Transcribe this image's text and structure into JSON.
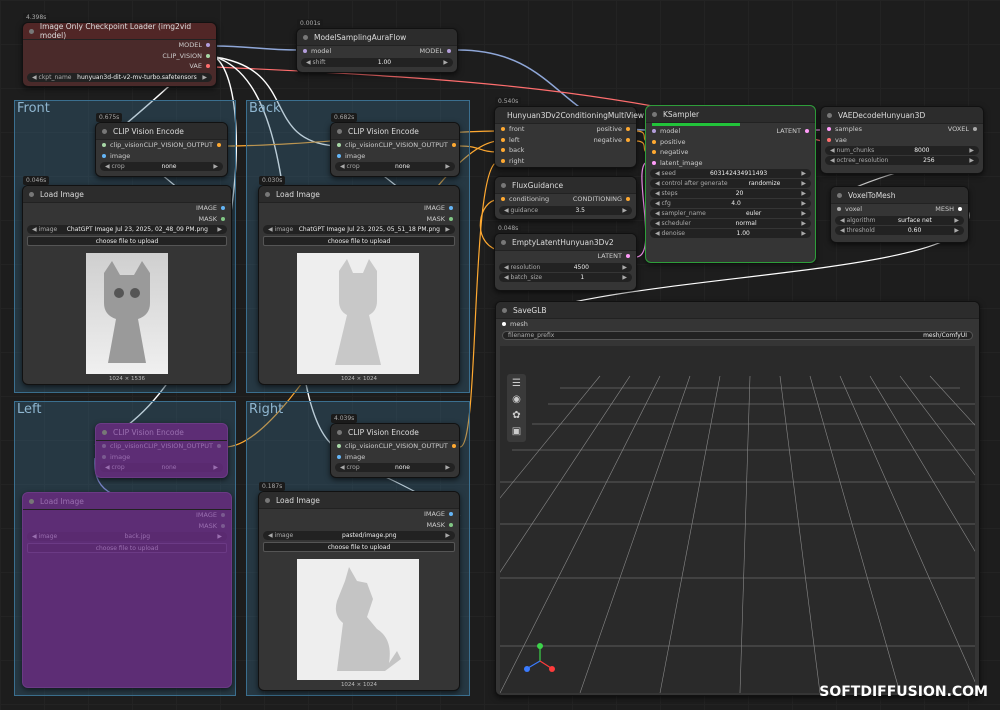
{
  "groups": {
    "front": "Front",
    "back": "Back",
    "left": "Left",
    "right": "Right"
  },
  "loader": {
    "time": "4.398s",
    "title": "Image Only Checkpoint Loader (img2vid model)",
    "out_model": "MODEL",
    "out_clip": "CLIP_VISION",
    "out_vae": "VAE",
    "ckpt_label": "ckpt_name",
    "ckpt_value": "hunyuan3d-dit-v2-mv-turbo.safetensors"
  },
  "aura": {
    "time": "0.001s",
    "title": "ModelSamplingAuraFlow",
    "in_model": "model",
    "out_model": "MODEL",
    "shift_label": "shift",
    "shift_value": "1.00"
  },
  "clip_front": {
    "time": "0.675s",
    "title": "CLIP Vision Encode",
    "in1": "clip_vision",
    "in2": "image",
    "out": "CLIP_VISION_OUTPUT",
    "crop_label": "crop",
    "crop_value": "none"
  },
  "clip_back": {
    "time": "0.682s",
    "title": "CLIP Vision Encode",
    "in1": "clip_vision",
    "in2": "image",
    "out": "CLIP_VISION_OUTPUT",
    "crop_label": "crop",
    "crop_value": "none"
  },
  "clip_left": {
    "title": "CLIP Vision Encode",
    "in1": "clip_vision",
    "in2": "image",
    "out": "CLIP_VISION_OUTPUT",
    "crop_label": "crop",
    "crop_value": "none"
  },
  "clip_right": {
    "time": "4.039s",
    "title": "CLIP Vision Encode",
    "in1": "clip_vision",
    "in2": "image",
    "out": "CLIP_VISION_OUTPUT",
    "crop_label": "crop",
    "crop_value": "none"
  },
  "load_front": {
    "time": "0.046s",
    "title": "Load Image",
    "out1": "IMAGE",
    "out2": "MASK",
    "image_label": "image",
    "image_value": "ChatGPT Image Jul 23, 2025, 02_48_09 PM.png",
    "upload": "choose file to upload",
    "dims": "1024 × 1536"
  },
  "load_back": {
    "time": "0.030s",
    "title": "Load Image",
    "out1": "IMAGE",
    "out2": "MASK",
    "image_label": "image",
    "image_value": "ChatGPT Image Jul 23, 2025, 05_51_18 PM.png",
    "upload": "choose file to upload",
    "dims": "1024 × 1024"
  },
  "load_left": {
    "title": "Load Image",
    "out1": "IMAGE",
    "out2": "MASK",
    "image_label": "image",
    "image_value": "back.jpg",
    "upload": "choose file to upload"
  },
  "load_right": {
    "time": "0.187s",
    "title": "Load Image",
    "out1": "IMAGE",
    "out2": "MASK",
    "image_label": "image",
    "image_value": "pasted/image.png",
    "upload": "choose file to upload",
    "dims": "1024 × 1024"
  },
  "mv": {
    "time": "0.540s",
    "title": "Hunyuan3Dv2ConditioningMultiView",
    "in_front": "front",
    "in_left": "left",
    "in_back": "back",
    "in_right": "right",
    "out_pos": "positive",
    "out_neg": "negative"
  },
  "flux": {
    "title": "FluxGuidance",
    "in": "conditioning",
    "out": "CONDITIONING",
    "g_label": "guidance",
    "g_value": "3.5"
  },
  "latent": {
    "time": "0.048s",
    "title": "EmptyLatentHunyuan3Dv2",
    "out": "LATENT",
    "res_label": "resolution",
    "res_value": "4500",
    "bs_label": "batch_size",
    "bs_value": "1"
  },
  "ksampler": {
    "title": "KSampler",
    "in_model": "model",
    "in_pos": "positive",
    "in_neg": "negative",
    "in_lat": "latent_image",
    "out": "LATENT",
    "widgets": [
      {
        "label": "seed",
        "value": "603142434911493"
      },
      {
        "label": "control after generate",
        "value": "randomize"
      },
      {
        "label": "steps",
        "value": "20"
      },
      {
        "label": "cfg",
        "value": "4.0"
      },
      {
        "label": "sampler_name",
        "value": "euler"
      },
      {
        "label": "scheduler",
        "value": "normal"
      },
      {
        "label": "denoise",
        "value": "1.00"
      }
    ]
  },
  "vae": {
    "title": "VAEDecodeHunyuan3D",
    "in1": "samples",
    "in2": "vae",
    "out": "VOXEL",
    "nc_label": "num_chunks",
    "nc_value": "8000",
    "oct_label": "octree_resolution",
    "oct_value": "256"
  },
  "voxel": {
    "title": "VoxelToMesh",
    "in": "voxel",
    "out": "MESH",
    "alg_label": "algorithm",
    "alg_value": "surface net",
    "th_label": "threshold",
    "th_value": "0.60"
  },
  "save": {
    "title": "SaveGLB",
    "in": "mesh",
    "prefix_label": "filename_prefix",
    "prefix_value": "mesh/ComfyUI"
  },
  "watermark": "SOFTDIFFUSION.COM",
  "colors": {
    "clip": "#a7d7a6",
    "image": "#64b5f6",
    "model": "#b39ddb",
    "vae": "#ff6e6e",
    "cond": "#ffa931",
    "latent": "#ff9cf9"
  }
}
